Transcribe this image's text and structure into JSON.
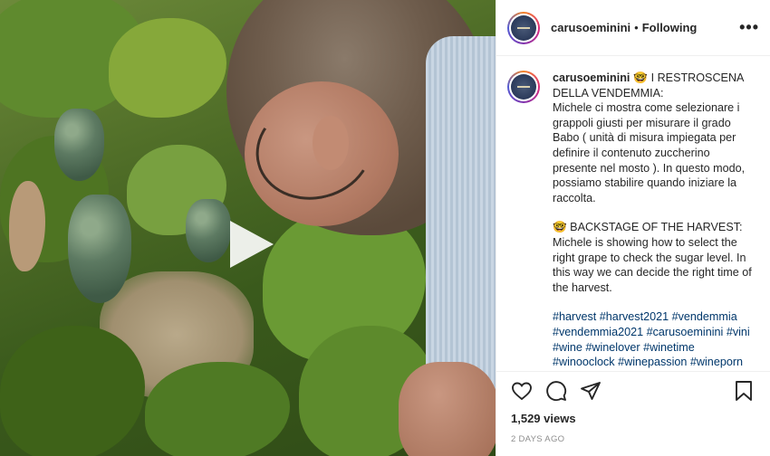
{
  "post": {
    "username": "carusoeminini",
    "follow_status": "Following",
    "separator": "•",
    "more_label": "•••"
  },
  "caption": {
    "username": "carusoeminini",
    "emoji": "🤓",
    "it_title": " I RESTROSCENA DELLA VENDEMMIA:",
    "it_body": "Michele ci mostra come selezionare i grappoli giusti per misurare il grado Babo ( unità di misura impiegata per definire il contenuto zuccherino presente nel mosto ). In questo modo, possiamo stabilire quando iniziare la raccolta.",
    "en_title": "🤓 BACKSTAGE OF THE HARVEST:",
    "en_body": "Michele is showing how to select the right grape to check the sugar level. In this way we can decide the right time of the harvest.",
    "hashtags": "#harvest #harvest2021 #vendemmia #vendemmia2021 #carusoeminini #vini #wine #winelover #winetime #winooclock #winepassion #wineporn"
  },
  "stats": {
    "views": "1,529 views",
    "date": "2 DAYS AGO"
  },
  "icons": {
    "play": "play-icon",
    "like": "heart-icon",
    "comment": "comment-icon",
    "share": "share-icon",
    "save": "bookmark-icon"
  },
  "colors": {
    "link": "#00376b",
    "text": "#262626",
    "muted": "#8e8e8e"
  }
}
